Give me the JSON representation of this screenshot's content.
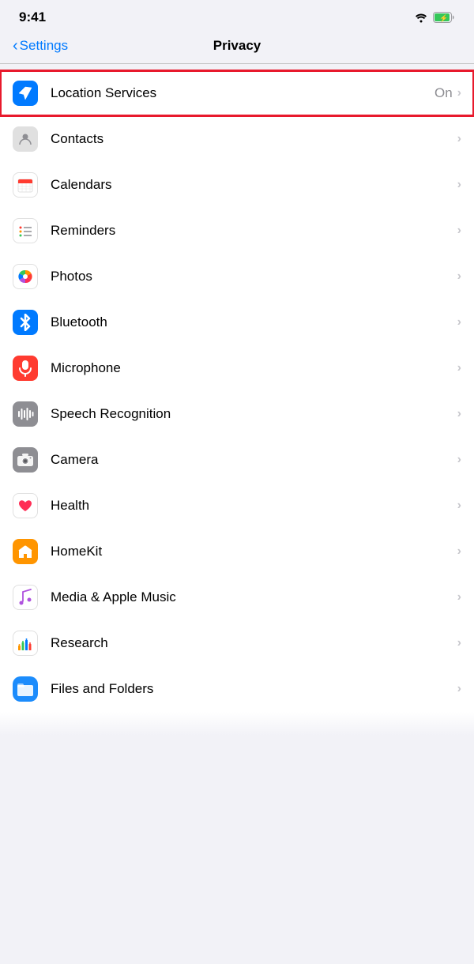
{
  "statusBar": {
    "time": "9:41",
    "wifi": "wifi-icon",
    "battery": "battery-icon"
  },
  "navigation": {
    "back_label": "Settings",
    "title": "Privacy"
  },
  "items": [
    {
      "id": "location-services",
      "label": "Location Services",
      "value": "On",
      "icon": "location-arrow",
      "highlighted": true
    },
    {
      "id": "contacts",
      "label": "Contacts",
      "value": "",
      "icon": "contacts"
    },
    {
      "id": "calendars",
      "label": "Calendars",
      "value": "",
      "icon": "calendars"
    },
    {
      "id": "reminders",
      "label": "Reminders",
      "value": "",
      "icon": "reminders"
    },
    {
      "id": "photos",
      "label": "Photos",
      "value": "",
      "icon": "photos"
    },
    {
      "id": "bluetooth",
      "label": "Bluetooth",
      "value": "",
      "icon": "bluetooth"
    },
    {
      "id": "microphone",
      "label": "Microphone",
      "value": "",
      "icon": "microphone"
    },
    {
      "id": "speech-recognition",
      "label": "Speech Recognition",
      "value": "",
      "icon": "speech"
    },
    {
      "id": "camera",
      "label": "Camera",
      "value": "",
      "icon": "camera"
    },
    {
      "id": "health",
      "label": "Health",
      "value": "",
      "icon": "health"
    },
    {
      "id": "homekit",
      "label": "HomeKit",
      "value": "",
      "icon": "homekit"
    },
    {
      "id": "media-apple-music",
      "label": "Media & Apple Music",
      "value": "",
      "icon": "music"
    },
    {
      "id": "research",
      "label": "Research",
      "value": "",
      "icon": "research"
    },
    {
      "id": "files-and-folders",
      "label": "Files and Folders",
      "value": "",
      "icon": "files"
    }
  ]
}
